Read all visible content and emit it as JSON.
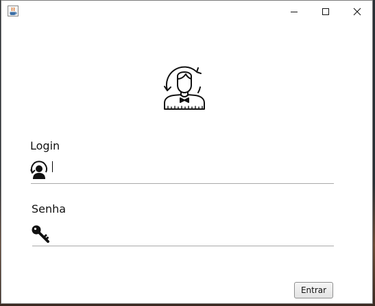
{
  "window": {
    "title": "",
    "controls": {
      "minimize": "minimize-icon",
      "maximize": "maximize-icon",
      "close": "close-icon"
    }
  },
  "logo": {
    "icon": "user-avatar-icon"
  },
  "login": {
    "label": "Login",
    "value": "",
    "icon": "user-refresh-icon"
  },
  "senha": {
    "label": "Senha",
    "value": "",
    "icon": "key-icon"
  },
  "actions": {
    "submit_label": "Entrar"
  },
  "colors": {
    "window_bg": "#ffffff",
    "underline": "#a9a9a9",
    "button_border": "#8e8f8f"
  }
}
